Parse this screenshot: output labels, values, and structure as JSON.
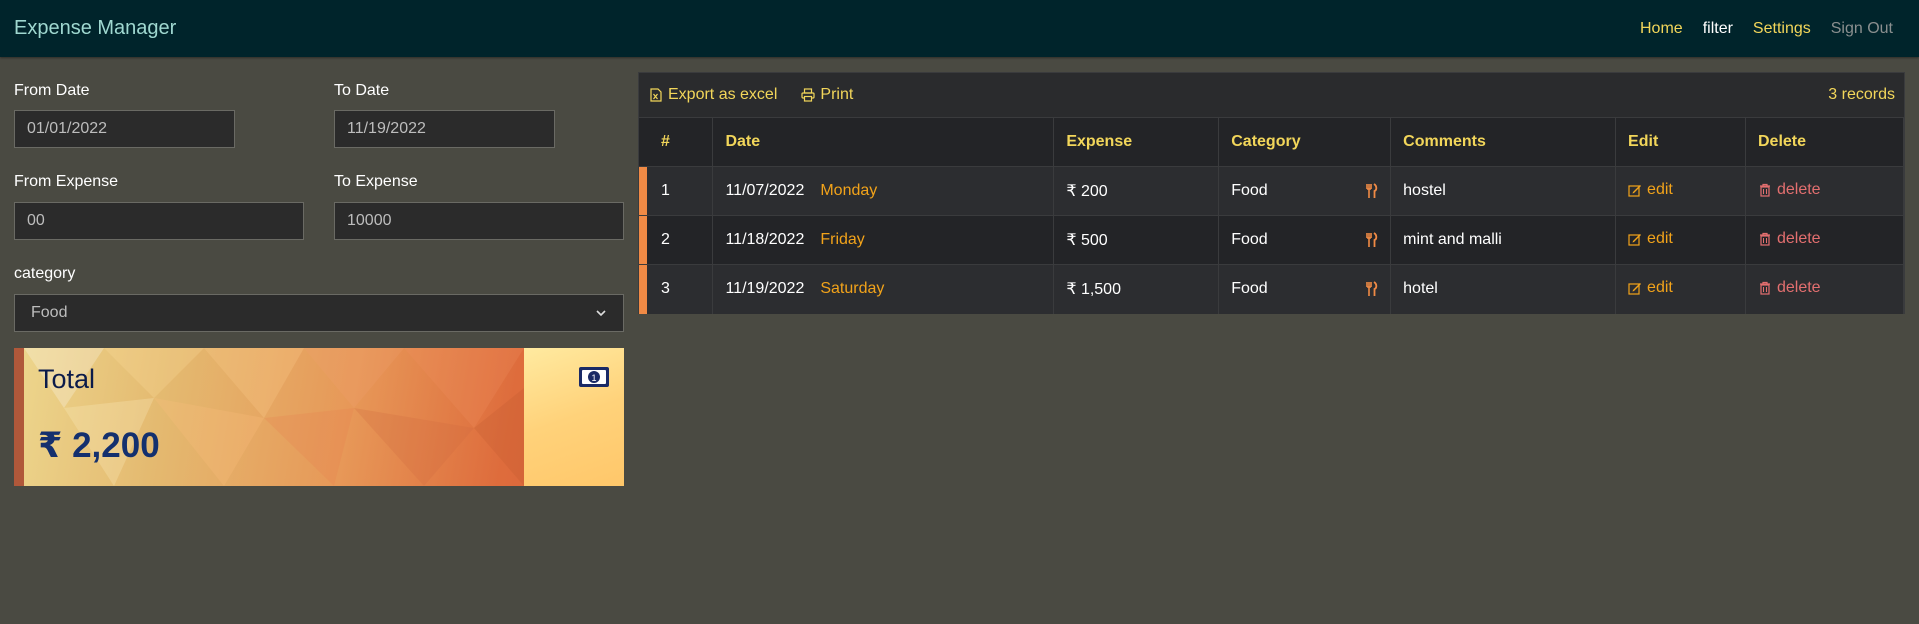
{
  "navbar": {
    "brand": "Expense Manager",
    "links": {
      "home": "Home",
      "filter": "filter",
      "settings": "Settings",
      "signout": "Sign Out"
    }
  },
  "filters": {
    "from_date": {
      "label": "From Date",
      "value": "01/01/2022"
    },
    "to_date": {
      "label": "To Date",
      "value": "11/19/2022"
    },
    "from_expense": {
      "label": "From Expense",
      "value": "00"
    },
    "to_expense": {
      "label": "To Expense",
      "value": "10000"
    },
    "category": {
      "label": "category",
      "value": "Food"
    }
  },
  "total": {
    "title": "Total",
    "amount": "₹ 2,200",
    "icon": "money-bill-icon"
  },
  "toolbar": {
    "export_label": "Export as excel",
    "print_label": "Print",
    "records": "3 records"
  },
  "table": {
    "headers": [
      "#",
      "Date",
      "Expense",
      "Category",
      "Comments",
      "Edit",
      "Delete"
    ],
    "rows": [
      {
        "index": "1",
        "date": "11/07/2022",
        "day": "Monday",
        "expense": "₹ 200",
        "category": "Food",
        "comment": "hostel",
        "edit": "edit",
        "delete": "delete"
      },
      {
        "index": "2",
        "date": "11/18/2022",
        "day": "Friday",
        "expense": "₹ 500",
        "category": "Food",
        "comment": "mint and malli",
        "edit": "edit",
        "delete": "delete"
      },
      {
        "index": "3",
        "date": "11/19/2022",
        "day": "Saturday",
        "expense": "₹ 1,500",
        "category": "Food",
        "comment": "hotel",
        "edit": "edit",
        "delete": "delete"
      }
    ]
  },
  "colors": {
    "navbar_bg": "#00242b",
    "page_bg": "#4a4a42",
    "accent_yellow": "#f2d65a",
    "accent_orange": "#f2a31a",
    "delete_red": "#e36f6f",
    "row_marker": "#f08a45"
  }
}
